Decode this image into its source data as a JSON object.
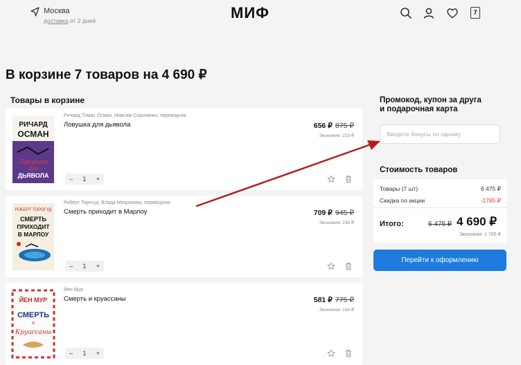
{
  "header": {
    "city": "Москва",
    "delivery_link": "доставка",
    "delivery_rest": " от 2 дней",
    "logo": "МИФ",
    "cart_count": "7"
  },
  "page": {
    "title": "В корзине 7 товаров на 4 690 ₽",
    "section_title": "Товары в корзине"
  },
  "items": [
    {
      "authors": "Ричард Томас Осман, Максим Сорочанко, переводчик",
      "title": "Ловушка для дьявола",
      "price": "656 ₽",
      "old_price": "875 ₽",
      "economy": "Экономия: 219 ₽",
      "qty": "1",
      "cover_color": "#5b3a8c",
      "cover_lines": [
        "РИЧАРД",
        "ОСМАН",
        "Ловушка",
        "для",
        "ДЬЯВОЛА"
      ]
    },
    {
      "authors": "Роберт Торогуд, Влада Мехрякова, переводчик",
      "title": "Смерть приходит в Марлоу",
      "price": "709 ₽",
      "old_price": "945 ₽",
      "economy": "Экономия: 236 ₽",
      "qty": "1",
      "cover_color": "#f4efe1",
      "cover_lines": [
        "РОБЕРТ ТОРОГУД",
        "СМЕРТЬ",
        "ПРИХОДИТ",
        "В МАРЛОУ"
      ]
    },
    {
      "authors": "Йен Мур",
      "title": "Смерть и круассаны",
      "price": "581 ₽",
      "old_price": "775 ₽",
      "economy": "Экономия: 194 ₽",
      "qty": "1",
      "cover_color": "#fbfbfb",
      "cover_lines": [
        "ЙЕН МУР",
        "СМЕРТЬ",
        "и",
        "Круассаны"
      ]
    }
  ],
  "promo": {
    "title_line1": "Промокод, купон за друга",
    "title_line2": "и подарочная карта",
    "placeholder": "Вводите бонусы по одному"
  },
  "cost": {
    "title": "Стоимость товаров",
    "items_label": "Товары (7 шт)",
    "items_value": "6 475 ₽",
    "discount_label": "Скидка по акции",
    "discount_value": "-1785 ₽",
    "total_label": "Итого:",
    "total_old": "6 475 ₽",
    "total_new": "4 690 ₽",
    "total_economy": "Экономия: 1 785 ₽"
  },
  "checkout_label": "Перейти к оформлению",
  "colors": {
    "accent": "#1e7bde",
    "discount": "#e53935",
    "annotation_arrow": "#b71c1c"
  }
}
